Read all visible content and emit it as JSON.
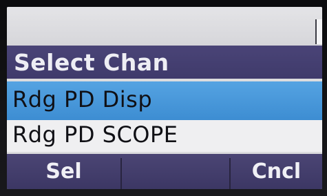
{
  "screen": {
    "title": "Select Chan",
    "items": [
      {
        "label": "Rdg PD Disp",
        "selected": true
      },
      {
        "label": "Rdg PD SCOPE",
        "selected": false
      }
    ],
    "softkeys": {
      "left": "Sel",
      "middle": "",
      "right": "Cncl"
    }
  },
  "colors": {
    "title_bar": "#433d70",
    "selection": "#4a98da",
    "background": "#dcdcde"
  }
}
